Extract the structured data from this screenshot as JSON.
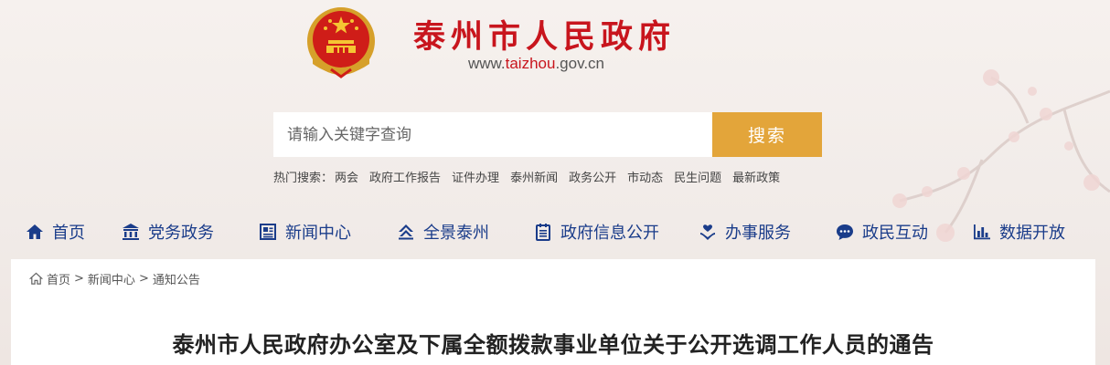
{
  "header": {
    "site_name": "泰州市人民政府",
    "url_prefix": "www.",
    "url_highlight": "taizhou",
    "url_suffix": ".gov.cn"
  },
  "search": {
    "placeholder": "请输入关键字查询",
    "button_label": "搜索",
    "hot_label": "热门搜索：",
    "hot_keywords": [
      "两会",
      "政府工作报告",
      "证件办理",
      "泰州新闻",
      "政务公开",
      "市动态",
      "民生问题",
      "最新政策"
    ]
  },
  "nav": {
    "items": [
      {
        "label": "首页",
        "icon": "home-icon"
      },
      {
        "label": "党务政务",
        "icon": "building-icon"
      },
      {
        "label": "新闻中心",
        "icon": "newspaper-icon"
      },
      {
        "label": "全景泰州",
        "icon": "landscape-icon"
      },
      {
        "label": "政府信息公开",
        "icon": "calendar-doc-icon"
      },
      {
        "label": "办事服务",
        "icon": "heart-hand-icon"
      },
      {
        "label": "政民互动",
        "icon": "chat-icon"
      },
      {
        "label": "数据开放",
        "icon": "bar-chart-icon"
      }
    ]
  },
  "breadcrumb": {
    "home": "首页",
    "section": "新闻中心",
    "current": "通知公告",
    "separator": ">"
  },
  "article": {
    "title": "泰州市人民政府办公室及下属全额拨款事业单位关于公开选调工作人员的通告"
  },
  "colors": {
    "brand_red": "#c8151d",
    "search_button": "#e3a53a",
    "nav_blue": "#1a3c8a"
  }
}
